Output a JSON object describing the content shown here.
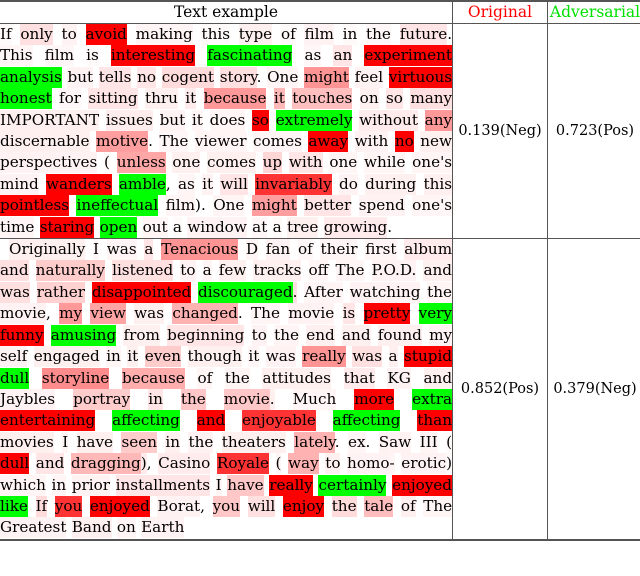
{
  "table": {
    "headers": {
      "text": "Text example",
      "original": "Original",
      "adversarial": "Adversarial"
    },
    "header_colors": {
      "original": "#ff0000",
      "adversarial": "#00ff00"
    },
    "highlight_colors": {
      "original_word": "#ff0000",
      "adversarial_word": "#00ff00",
      "saliency_base": "#ff0000"
    },
    "rows": [
      {
        "id": "row-1",
        "original_score": "0.139(Neg)",
        "adversarial_score": "0.723(Pos)",
        "tokens": [
          {
            "t": "If",
            "s": 0.02
          },
          {
            "t": "only",
            "s": 0.12
          },
          {
            "t": "to",
            "s": 0.05
          },
          {
            "t": "avoid",
            "k": "orig"
          },
          {
            "t": "making",
            "s": 0.04
          },
          {
            "t": "this",
            "s": 0.02
          },
          {
            "t": "type",
            "s": 0.06
          },
          {
            "t": "of",
            "s": 0.02
          },
          {
            "t": "film",
            "s": 0.05
          },
          {
            "t": "in",
            "s": 0.02
          },
          {
            "t": "the",
            "s": 0.03
          },
          {
            "t": "future",
            "s": 0.1
          },
          {
            "t": ".",
            "s": 0
          },
          {
            "t": "This",
            "s": 0.04
          },
          {
            "t": "film",
            "s": 0.03
          },
          {
            "t": "is",
            "s": 0.02
          },
          {
            "t": "interesting",
            "k": "orig"
          },
          {
            "t": "fascinating",
            "k": "adv"
          },
          {
            "t": "as",
            "s": 0.03
          },
          {
            "t": "an",
            "s": 0.1
          },
          {
            "t": "experiment",
            "k": "orig"
          },
          {
            "t": "analysis",
            "k": "adv"
          },
          {
            "t": "but",
            "s": 0.05
          },
          {
            "t": "tells",
            "s": 0.1
          },
          {
            "t": "no",
            "s": 0.1
          },
          {
            "t": "cogent",
            "s": 0.14
          },
          {
            "t": "story",
            "s": 0.12
          },
          {
            "t": ".",
            "s": 0
          },
          {
            "t": "One",
            "s": 0.04
          },
          {
            "t": "might",
            "s": 0.42
          },
          {
            "t": "feel",
            "s": 0.05
          },
          {
            "t": "virtuous",
            "k": "orig"
          },
          {
            "t": "honest",
            "k": "adv"
          },
          {
            "t": "for",
            "s": 0.03
          },
          {
            "t": "sitting",
            "s": 0.1
          },
          {
            "t": "thru",
            "s": 0.06
          },
          {
            "t": "it",
            "s": 0.08
          },
          {
            "t": "because",
            "s": 0.4
          },
          {
            "t": "it",
            "s": 0.28
          },
          {
            "t": "touches",
            "s": 0.25
          },
          {
            "t": "on",
            "s": 0.06
          },
          {
            "t": "so",
            "s": 0.1
          },
          {
            "t": "many",
            "s": 0.12
          },
          {
            "t": "IMPORTANT",
            "s": 0.06
          },
          {
            "t": "issues",
            "s": 0.07
          },
          {
            "t": "but",
            "s": 0.05
          },
          {
            "t": "it",
            "s": 0.04
          },
          {
            "t": "does",
            "s": 0.04
          },
          {
            "t": "so",
            "k": "orig"
          },
          {
            "t": "extremely",
            "k": "adv"
          },
          {
            "t": "without",
            "s": 0.08
          },
          {
            "t": "any",
            "s": 0.4
          },
          {
            "t": "discernable",
            "s": 0.06
          },
          {
            "t": "motive",
            "s": 0.38
          },
          {
            "t": ".",
            "s": 0
          },
          {
            "t": "The",
            "s": 0.03
          },
          {
            "t": "viewer",
            "s": 0.04
          },
          {
            "t": "comes",
            "s": 0.04
          },
          {
            "t": "away",
            "k": "orig"
          },
          {
            "t": "with",
            "s": 0.05
          },
          {
            "t": "no",
            "k": "orig"
          },
          {
            "t": "new",
            "s": 0.06
          },
          {
            "t": "perspectives",
            "s": 0.05
          },
          {
            "t": "(",
            "s": 0.02
          },
          {
            "t": "unless",
            "s": 0.35
          },
          {
            "t": "one",
            "s": 0.06
          },
          {
            "t": "comes",
            "s": 0.06
          },
          {
            "t": "up",
            "s": 0.16
          },
          {
            "t": "with",
            "s": 0.1
          },
          {
            "t": "one",
            "s": 0.04
          },
          {
            "t": "while",
            "s": 0.04
          },
          {
            "t": "one",
            "s": 0.04
          },
          {
            "t": "'s",
            "s": 0.04
          },
          {
            "t": "mind",
            "s": 0.05
          },
          {
            "t": "wanders",
            "k": "orig"
          },
          {
            "t": "amble",
            "k": "adv"
          },
          {
            "t": ",",
            "s": 0
          },
          {
            "t": "as",
            "s": 0.04
          },
          {
            "t": "it",
            "s": 0.05
          },
          {
            "t": "will",
            "s": 0.1
          },
          {
            "t": "invariably",
            "k": "orig",
            "soft": true
          },
          {
            "t": "do",
            "s": 0.05
          },
          {
            "t": "during",
            "s": 0.06
          },
          {
            "t": "this",
            "s": 0.06
          },
          {
            "t": "pointless",
            "k": "orig"
          },
          {
            "t": "ineffectual",
            "k": "adv"
          },
          {
            "t": "film",
            "s": 0.04
          },
          {
            "t": ")",
            "s": 0
          },
          {
            "t": ".",
            "s": 0
          },
          {
            "t": "One",
            "s": 0.04
          },
          {
            "t": "might",
            "s": 0.38
          },
          {
            "t": "better",
            "s": 0.1
          },
          {
            "t": "spend",
            "s": 0.05
          },
          {
            "t": "one",
            "s": 0.04
          },
          {
            "t": "'s",
            "s": 0.03
          },
          {
            "t": "time",
            "s": 0.04
          },
          {
            "t": "staring",
            "k": "orig"
          },
          {
            "t": "open",
            "k": "adv"
          },
          {
            "t": "out",
            "s": 0.04
          },
          {
            "t": "a",
            "s": 0.02
          },
          {
            "t": "window",
            "s": 0.05
          },
          {
            "t": "at",
            "s": 0.03
          },
          {
            "t": "a",
            "s": 0.02
          },
          {
            "t": "tree",
            "s": 0.06
          },
          {
            "t": "growing",
            "s": 0.08
          },
          {
            "t": ".",
            "s": 0
          }
        ]
      },
      {
        "id": "row-2",
        "original_score": "0.852(Pos)",
        "adversarial_score": "0.379(Neg)",
        "indent": true,
        "tokens": [
          {
            "t": "Originally",
            "s": 0.06
          },
          {
            "t": "I",
            "s": 0.03
          },
          {
            "t": "was",
            "s": 0.04
          },
          {
            "t": "a",
            "s": 0.1
          },
          {
            "t": "Tenacious",
            "s": 0.42
          },
          {
            "t": "D",
            "s": 0.04
          },
          {
            "t": "fan",
            "s": 0.05
          },
          {
            "t": "of",
            "s": 0.03
          },
          {
            "t": "their",
            "s": 0.04
          },
          {
            "t": "first",
            "s": 0.04
          },
          {
            "t": "album",
            "s": 0.08
          },
          {
            "t": "and",
            "s": 0.12
          },
          {
            "t": "naturally",
            "s": 0.2
          },
          {
            "t": "listened",
            "s": 0.12
          },
          {
            "t": "to",
            "s": 0.05
          },
          {
            "t": "a",
            "s": 0.04
          },
          {
            "t": "few",
            "s": 0.06
          },
          {
            "t": "tracks",
            "s": 0.06
          },
          {
            "t": "off",
            "s": 0.04
          },
          {
            "t": "The",
            "s": 0.04
          },
          {
            "t": "P.O.D.",
            "s": 0.05
          },
          {
            "t": "and",
            "s": 0.06
          },
          {
            "t": "was",
            "s": 0.12
          },
          {
            "t": "rather",
            "s": 0.18
          },
          {
            "t": "disappointed",
            "k": "orig"
          },
          {
            "t": "discouraged",
            "k": "adv"
          },
          {
            "t": ".",
            "s": 0.12
          },
          {
            "t": "After",
            "s": 0.04
          },
          {
            "t": "watching",
            "s": 0.05
          },
          {
            "t": "the",
            "s": 0.04
          },
          {
            "t": "movie",
            "s": 0.05
          },
          {
            "t": ",",
            "s": 0
          },
          {
            "t": "my",
            "s": 0.4
          },
          {
            "t": "view",
            "s": 0.36
          },
          {
            "t": "was",
            "s": 0.06
          },
          {
            "t": "changed",
            "s": 0.3
          },
          {
            "t": ".",
            "s": 0
          },
          {
            "t": "The",
            "s": 0.04
          },
          {
            "t": "movie",
            "s": 0.05
          },
          {
            "t": "is",
            "s": 0.1
          },
          {
            "t": "pretty",
            "k": "orig"
          },
          {
            "t": "very",
            "k": "adv"
          },
          {
            "t": "funny",
            "k": "orig"
          },
          {
            "t": "amusing",
            "k": "adv"
          },
          {
            "t": "from",
            "s": 0.06
          },
          {
            "t": "beginning",
            "s": 0.1
          },
          {
            "t": "to",
            "s": 0.05
          },
          {
            "t": "the",
            "s": 0.04
          },
          {
            "t": "end",
            "s": 0.06
          },
          {
            "t": "and",
            "s": 0.06
          },
          {
            "t": "found",
            "s": 0.06
          },
          {
            "t": "my",
            "s": 0.05
          },
          {
            "t": "self",
            "s": 0.05
          },
          {
            "t": "engaged",
            "s": 0.06
          },
          {
            "t": "in",
            "s": 0.04
          },
          {
            "t": "it",
            "s": 0.06
          },
          {
            "t": "even",
            "s": 0.2
          },
          {
            "t": "though",
            "s": 0.06
          },
          {
            "t": "it",
            "s": 0.04
          },
          {
            "t": "was",
            "s": 0.05
          },
          {
            "t": "really",
            "s": 0.42
          },
          {
            "t": "was",
            "s": 0.12
          },
          {
            "t": "a",
            "s": 0.06
          },
          {
            "t": "stupid",
            "k": "orig"
          },
          {
            "t": "dull",
            "k": "adv"
          },
          {
            "t": "storyline",
            "s": 0.45
          },
          {
            "t": "because",
            "s": 0.32
          },
          {
            "t": "of",
            "s": 0.04
          },
          {
            "t": "the",
            "s": 0.04
          },
          {
            "t": "attitudes",
            "s": 0.06
          },
          {
            "t": "that",
            "s": 0.08
          },
          {
            "t": "KG",
            "s": 0.05
          },
          {
            "t": "and",
            "s": 0.06
          },
          {
            "t": "Jaybles",
            "s": 0.05
          },
          {
            "t": "portray",
            "s": 0.2
          },
          {
            "t": "in",
            "s": 0.1
          },
          {
            "t": "the",
            "s": 0.22
          },
          {
            "t": "movie",
            "s": 0.22
          },
          {
            "t": ".",
            "s": 0.06
          },
          {
            "t": "Much",
            "s": 0.04
          },
          {
            "t": "more",
            "k": "orig"
          },
          {
            "t": "extra",
            "k": "adv"
          },
          {
            "t": "entertaining",
            "k": "orig"
          },
          {
            "t": "affecting",
            "k": "adv"
          },
          {
            "t": "and",
            "k": "orig"
          },
          {
            "t": "enjoyable",
            "k": "orig",
            "soft": true
          },
          {
            "t": "affecting",
            "k": "adv"
          },
          {
            "t": "than",
            "k": "orig"
          },
          {
            "t": "movies",
            "s": 0.06
          },
          {
            "t": "I",
            "s": 0.04
          },
          {
            "t": "have",
            "s": 0.06
          },
          {
            "t": "seen",
            "s": 0.2
          },
          {
            "t": "in",
            "s": 0.06
          },
          {
            "t": "the",
            "s": 0.05
          },
          {
            "t": "theaters",
            "s": 0.06
          },
          {
            "t": "lately",
            "s": 0.3
          },
          {
            "t": ".",
            "s": 0
          },
          {
            "t": "ex",
            "s": 0.04
          },
          {
            "t": ".",
            "s": 0
          },
          {
            "t": "Saw",
            "s": 0.05
          },
          {
            "t": "III",
            "s": 0.04
          },
          {
            "t": "(",
            "s": 0.02
          },
          {
            "t": "dull",
            "k": "orig"
          },
          {
            "t": "and",
            "s": 0.1
          },
          {
            "t": "dragging",
            "s": 0.28
          },
          {
            "t": ")",
            "s": 0.08
          },
          {
            "t": ",",
            "s": 0
          },
          {
            "t": "Casino",
            "s": 0.08
          },
          {
            "t": "Royale",
            "k": "orig",
            "soft": true
          },
          {
            "t": "(",
            "s": 0.04
          },
          {
            "t": "way",
            "s": 0.3
          },
          {
            "t": "to",
            "s": 0.06
          },
          {
            "t": "homo",
            "s": 0.05
          },
          {
            "t": "-",
            "s": 0.04
          },
          {
            "t": "erotic",
            "s": 0.05
          },
          {
            "t": ")",
            "s": 0.02
          },
          {
            "t": "which",
            "s": 0.04
          },
          {
            "t": "in",
            "s": 0.04
          },
          {
            "t": "prior",
            "s": 0.05
          },
          {
            "t": "installments",
            "s": 0.1
          },
          {
            "t": "I",
            "s": 0.04
          },
          {
            "t": "have",
            "s": 0.22
          },
          {
            "t": "really",
            "k": "orig"
          },
          {
            "t": "certainly",
            "k": "adv"
          },
          {
            "t": "enjoyed",
            "k": "orig"
          },
          {
            "t": "like",
            "k": "adv"
          },
          {
            "t": "If",
            "s": 0.14
          },
          {
            "t": "you",
            "k": "orig",
            "soft": true
          },
          {
            "t": "enjoyed",
            "k": "orig"
          },
          {
            "t": "Borat",
            "s": 0.05
          },
          {
            "t": ",",
            "s": 0
          },
          {
            "t": "you",
            "s": 0.22
          },
          {
            "t": "will",
            "s": 0.12
          },
          {
            "t": "enjoy",
            "k": "orig"
          },
          {
            "t": "the",
            "s": 0.14
          },
          {
            "t": "tale",
            "s": 0.26
          },
          {
            "t": "of",
            "s": 0.06
          },
          {
            "t": "The",
            "s": 0.04
          },
          {
            "t": "Greatest",
            "s": 0.05
          },
          {
            "t": "Band",
            "s": 0.06
          },
          {
            "t": "on",
            "s": 0.04
          },
          {
            "t": "Earth",
            "s": 0.05
          }
        ]
      }
    ]
  }
}
